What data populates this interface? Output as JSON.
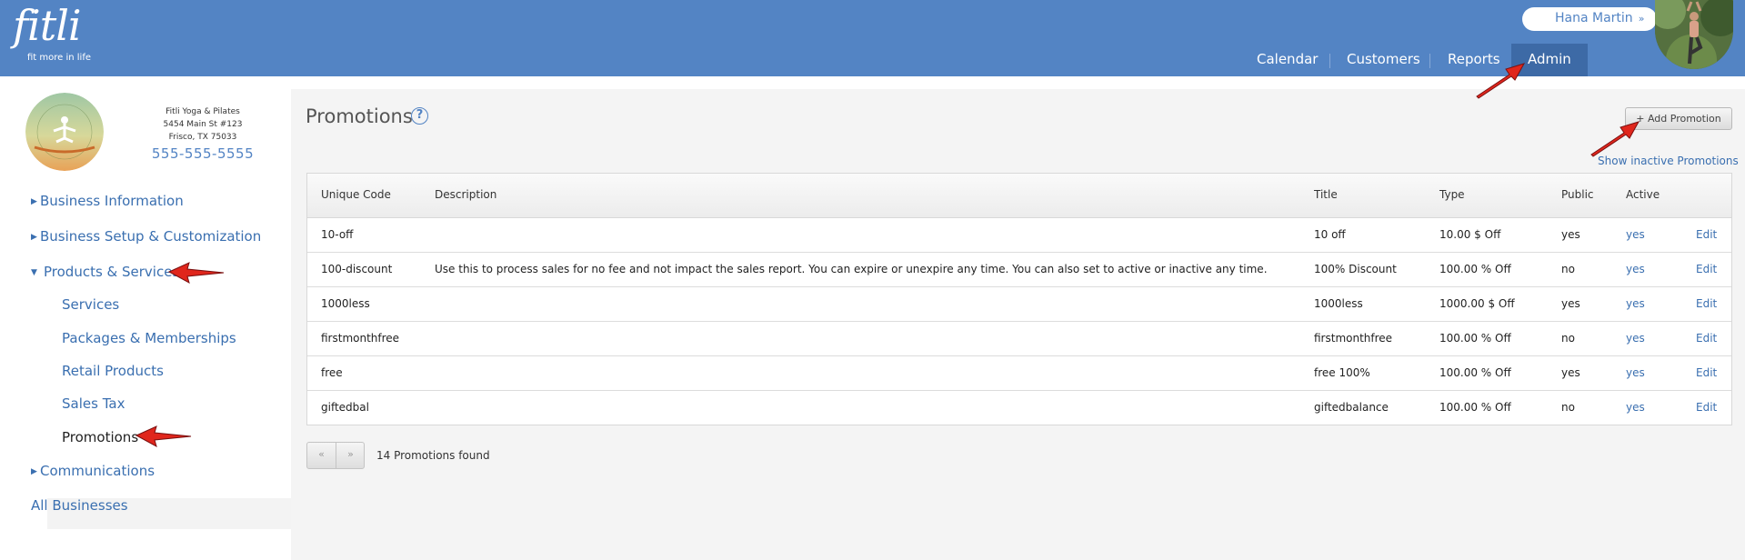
{
  "app": {
    "logo_text": "fitli",
    "tagline": "fit more in life"
  },
  "user": {
    "name": "Hana Martin"
  },
  "nav": [
    {
      "label": "Calendar",
      "active": false
    },
    {
      "label": "Customers",
      "active": false
    },
    {
      "label": "Reports",
      "active": false
    },
    {
      "label": "Admin",
      "active": true
    }
  ],
  "business": {
    "logo_text": "FITLI YOGA & PILATES",
    "name": "Fitli Yoga & Pilates",
    "address1": "5454 Main St #123",
    "address2": "Frisco, TX 75033",
    "phone": "555-555-5555"
  },
  "sidebar": {
    "items": [
      {
        "label": "Business Information",
        "expanded": false
      },
      {
        "label": "Business Setup & Customization",
        "expanded": false
      },
      {
        "label": "Products & Services",
        "expanded": true
      },
      {
        "label": "Communications",
        "expanded": false
      }
    ],
    "subitems": [
      "Services",
      "Packages & Memberships",
      "Retail Products",
      "Sales Tax",
      "Promotions"
    ],
    "active_subitem": "Promotions",
    "all_businesses": "All Businesses"
  },
  "main": {
    "title": "Promotions",
    "help_icon": "?",
    "add_button": "+ Add Promotion",
    "show_inactive": "Show inactive Promotions",
    "columns": [
      "Unique Code",
      "Description",
      "Title",
      "Type",
      "Public",
      "Active",
      ""
    ],
    "rows": [
      {
        "code": "10-off",
        "description": "",
        "title": "10 off",
        "type": "10.00 $ Off",
        "public": "yes",
        "active": "yes",
        "action": "Edit"
      },
      {
        "code": "100-discount",
        "description": "Use this to process sales for no fee and not impact the sales report. You can expire or unexpire any time. You can also set to active or inactive any time.",
        "title": "100% Discount",
        "type": "100.00 % Off",
        "public": "no",
        "active": "yes",
        "action": "Edit"
      },
      {
        "code": "1000less",
        "description": "",
        "title": "1000less",
        "type": "1000.00 $ Off",
        "public": "yes",
        "active": "yes",
        "action": "Edit"
      },
      {
        "code": "firstmonthfree",
        "description": "",
        "title": "firstmonthfree",
        "type": "100.00 % Off",
        "public": "no",
        "active": "yes",
        "action": "Edit"
      },
      {
        "code": "free",
        "description": "",
        "title": "free 100%",
        "type": "100.00 % Off",
        "public": "yes",
        "active": "yes",
        "action": "Edit"
      },
      {
        "code": "giftedbal",
        "description": "",
        "title": "giftedbalance",
        "type": "100.00 % Off",
        "public": "no",
        "active": "yes",
        "action": "Edit"
      }
    ],
    "pager": {
      "prev": "«",
      "next": "»"
    },
    "count_text": "14 Promotions found"
  },
  "colors": {
    "header": "#5384c4",
    "nav_active": "#3d6aa6",
    "link": "#3a6fb0",
    "arrow": "#e0261c"
  }
}
